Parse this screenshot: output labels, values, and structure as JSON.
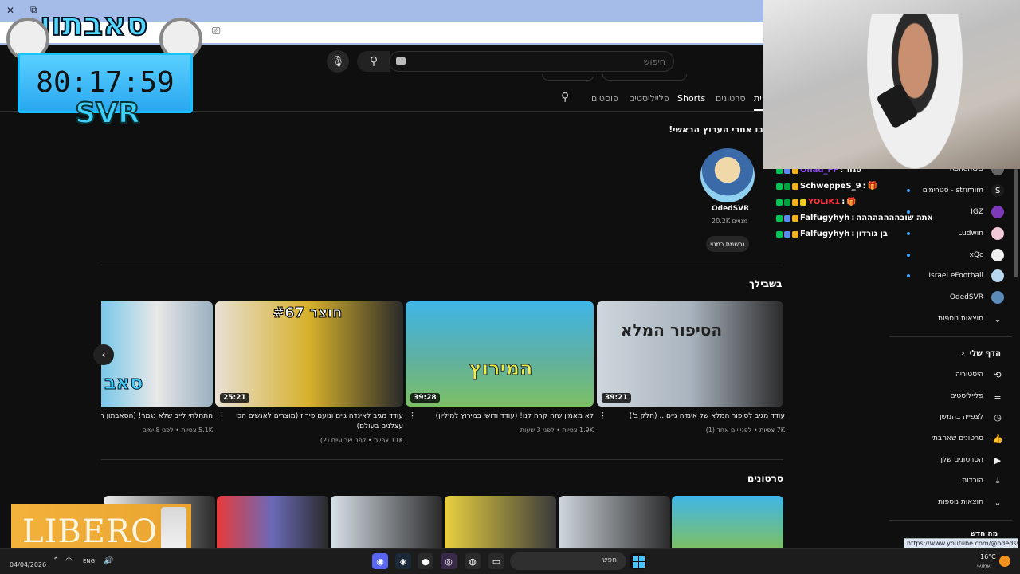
{
  "browser": {
    "close_glyph": "✕",
    "restore_glyph": "⧉",
    "url_icon": "⎚"
  },
  "search": {
    "placeholder": "חיפוש",
    "search_icon": "search-icon",
    "mic_icon": "mic-icon"
  },
  "channel_tabs": [
    {
      "label": "ית",
      "selected": true
    },
    {
      "label": "סרטונים"
    },
    {
      "label": "Shorts"
    },
    {
      "label": "פלייליסטים"
    },
    {
      "label": "פוסטים"
    }
  ],
  "featured": {
    "heading": "בו אחרי הערוץ הראשי!",
    "channel_name": "OdedSVR",
    "subscribers": "20.2K מנויים",
    "subscribed_button": "נרשמת כמנוי"
  },
  "for_you": {
    "title": "בשבילך",
    "videos": [
      {
        "title": "עודד מגיב לסיפור המלא של אינדה גיים... (חלק ב')",
        "meta": "7K צפיות • לפני יום אחד (1)",
        "duration": "39:21",
        "thumb_text": "הסיפור המלא",
        "thumb_colors": [
          "#cfd6dd",
          "#2b2b2b"
        ]
      },
      {
        "title": "לא מאמין שזה קרה לנו! (עודד ודושי במירוץ למיליון)",
        "meta": "1.9K צפיות • לפני 3 שעות",
        "duration": "39:28",
        "thumb_text": "המירוץ",
        "thumb_colors": [
          "#3fb6e8",
          "#7cc064"
        ]
      },
      {
        "title": "עודד מגיב לאינדה גיים ונועם פירוז (מוצרים לאנשים הכי עצלנים בעולם)",
        "meta": "11K צפיות • לפני שבועיים (2)",
        "duration": "25:21",
        "thumb_text": "#67 חוצר",
        "thumb_colors": [
          "#e8e0d4",
          "#d6b12a"
        ]
      },
      {
        "title": "התחלתי לייב שלא נגמר! (הסאבתון חוזר",
        "meta": "5.1K צפיות • לפני 8 ימים",
        "duration": "",
        "thumb_text": "סאב",
        "thumb_colors": [
          "#7ac8e8",
          "#e8e8e8"
        ]
      }
    ]
  },
  "videos_section": {
    "title": "סרטונים"
  },
  "sidebar": {
    "subscriptions": [
      {
        "label": "RonenGG",
        "live": false,
        "avatar_color": "#666"
      },
      {
        "label": "סטרימים - strimim",
        "live": true,
        "avatar_color": "#6a4bd6"
      },
      {
        "label": "IGZ",
        "live": true,
        "avatar_color": "#7d3ab8"
      },
      {
        "label": "Ludwin",
        "live": true,
        "avatar_color": "#f0c8d8"
      },
      {
        "label": "xQc",
        "live": true,
        "avatar_color": "#f0f0f0"
      },
      {
        "label": "Israel eFootball",
        "live": true,
        "avatar_color": "#b8d8f0"
      },
      {
        "label": "OdedSVR",
        "live": false,
        "avatar_color": "#5a8ab8"
      }
    ],
    "more_results_1": "תוצאות נוספות",
    "my_page": "הדף שלי",
    "library": [
      {
        "label": "היסטוריה",
        "icon": "history-icon",
        "glyph": "⟲"
      },
      {
        "label": "פלייליסטים",
        "icon": "playlist-icon",
        "glyph": "≡"
      },
      {
        "label": "לצפייה בהמשך",
        "icon": "clock-icon",
        "glyph": "◷"
      },
      {
        "label": "סרטונים שאהבתי",
        "icon": "thumbs-up-icon",
        "glyph": "👍"
      },
      {
        "label": "הסרטונים שלך",
        "icon": "video-icon",
        "glyph": "▶"
      },
      {
        "label": "הורדות",
        "icon": "download-icon",
        "glyph": "⤓"
      }
    ],
    "more_results_2": "תוצאות נוספות",
    "status_url": "https://www.youtube.com/@odedsvr95",
    "bottom_text": "מה חדש"
  },
  "chat": [
    {
      "user": "Ohad_FF",
      "message": "סגור",
      "color": "#9147ff"
    },
    {
      "user": "SchweppeS_9",
      "message": "🎁",
      "color": "#ffffff"
    },
    {
      "user": "YOLIK1",
      "message": "🎁",
      "color": "#ff3344"
    },
    {
      "user": "Falfugyhyh",
      "message": "אתה שובהההההההה",
      "color": "#ffffff"
    },
    {
      "user": "Falfugyhyh",
      "message": "בן גורדון",
      "color": "#ffffff"
    }
  ],
  "overlay": {
    "timer": "80:17:59",
    "brand": "SVR",
    "logo": "סאבתון",
    "sponsor": "LIBERO"
  },
  "taskbar": {
    "date": "04/04/2026",
    "lang": "ENG",
    "search_placeholder": "חפש",
    "weather_temp": "16°C",
    "weather_label": "שמשי"
  }
}
